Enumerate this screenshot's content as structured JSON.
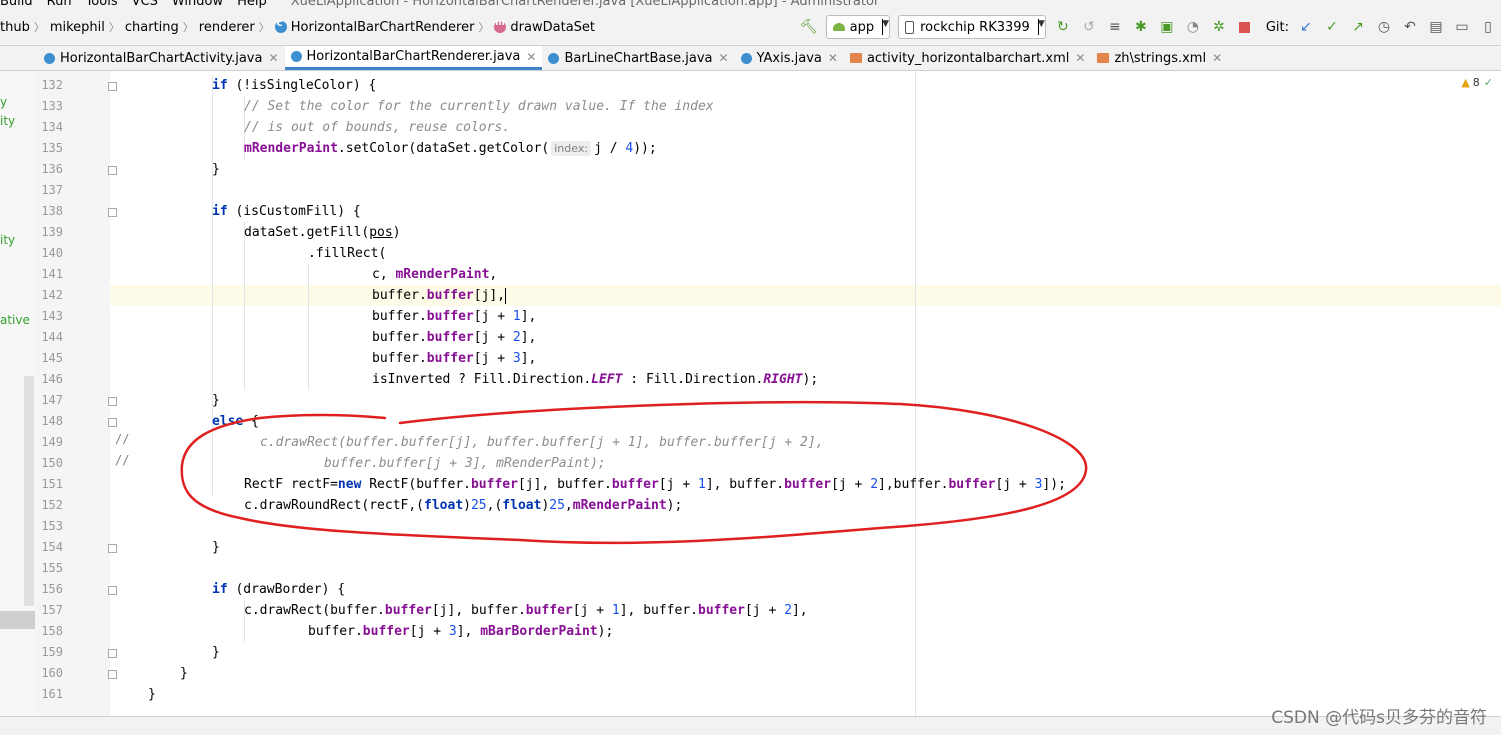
{
  "menu": {
    "items": [
      "Build",
      "Run",
      "Tools",
      "VCS",
      "Window",
      "Help"
    ],
    "window_title": "XueLiApplication - HorizontalBarChartRenderer.java [XueLiApplication.app] - Administrator"
  },
  "breadcrumb": [
    "thub",
    "mikephil",
    "charting",
    "renderer",
    "HorizontalBarChartRenderer",
    "drawDataSet"
  ],
  "toolbar": {
    "run_config": "app",
    "device": "rockchip RK3399",
    "git_label": "Git:"
  },
  "tabs": [
    {
      "label": "HorizontalBarChartActivity.java",
      "type": "java",
      "active": false
    },
    {
      "label": "HorizontalBarChartRenderer.java",
      "type": "java",
      "active": true
    },
    {
      "label": "BarLineChartBase.java",
      "type": "java",
      "active": false
    },
    {
      "label": "YAxis.java",
      "type": "java",
      "active": false
    },
    {
      "label": "activity_horizontalbarchart.xml",
      "type": "xml",
      "active": false
    },
    {
      "label": "zh\\strings.xml",
      "type": "xml",
      "active": false
    }
  ],
  "left_panel": {
    "fragments": [
      "y",
      "ity",
      "ity",
      "ative"
    ]
  },
  "editor": {
    "warning_count": "8",
    "line_numbers": [
      "132",
      "133",
      "134",
      "135",
      "136",
      "137",
      "138",
      "139",
      "140",
      "141",
      "142",
      "143",
      "144",
      "145",
      "146",
      "147",
      "148",
      "149",
      "150",
      "151",
      "152",
      "153",
      "154",
      "155",
      "156",
      "157",
      "158",
      "159",
      "160",
      "161"
    ],
    "current_line": "142",
    "commented_gutter_marks": [
      "//",
      "//"
    ],
    "param_hint": "index:"
  },
  "watermark": "CSDN @代码s贝多芬的音符"
}
